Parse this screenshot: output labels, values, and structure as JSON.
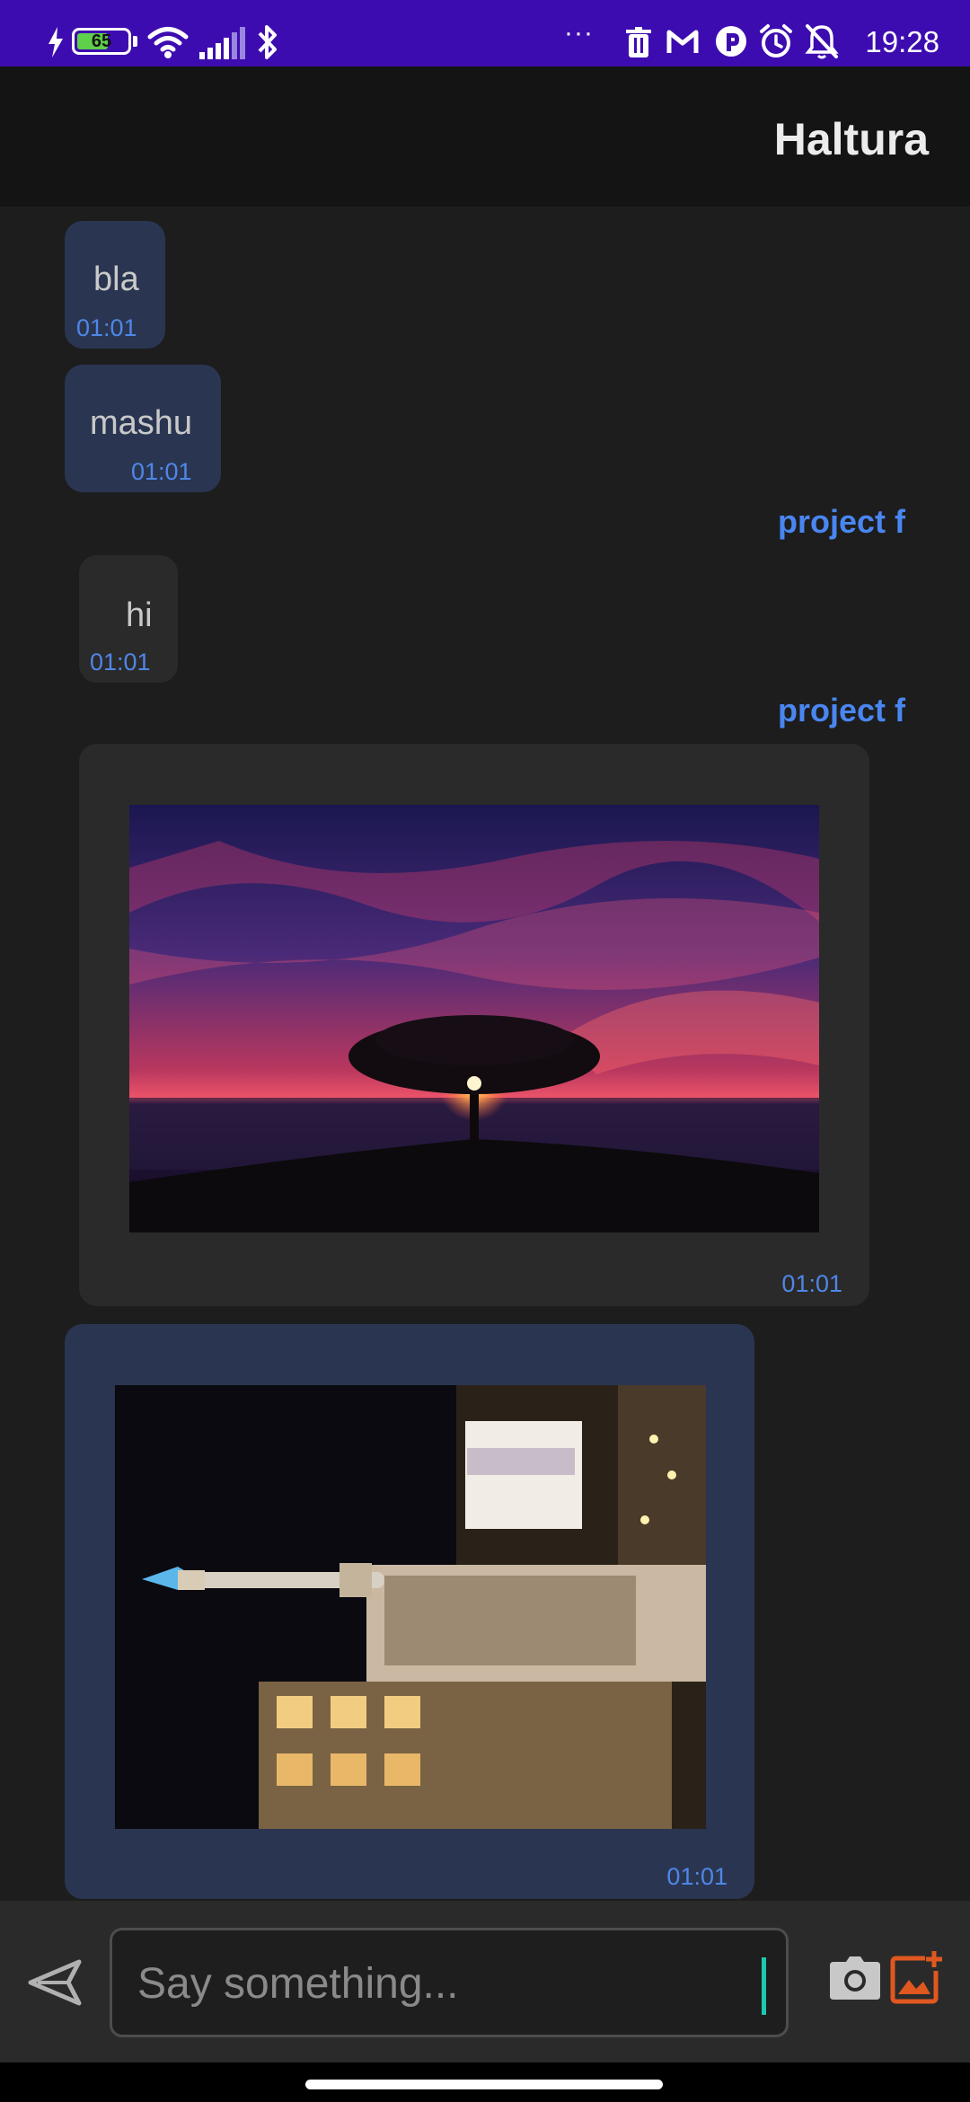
{
  "status_bar": {
    "battery": "65",
    "clock": "19:28",
    "icons": [
      "charging-icon",
      "wifi-icon",
      "signal-icon",
      "bluetooth-icon",
      "more-icon",
      "trash-icon",
      "gmail-icon",
      "app-icon",
      "alarm-icon",
      "bell-off-icon"
    ],
    "more": "···"
  },
  "app_bar": {
    "title": "Haltura"
  },
  "messages": [
    {
      "type": "text",
      "side": "mine",
      "text": "bla",
      "time": "01:01"
    },
    {
      "type": "text",
      "side": "mine",
      "text": "mashu",
      "time": "01:01"
    },
    {
      "type": "sender",
      "name": "project f"
    },
    {
      "type": "text",
      "side": "other",
      "text": "hi",
      "time": "01:01"
    },
    {
      "type": "sender",
      "name": "project f"
    },
    {
      "type": "image",
      "side": "other",
      "image": "sunset-tree-photo",
      "time": "01:01"
    },
    {
      "type": "image",
      "side": "mine",
      "image": "night-column-photo",
      "time": "01:01"
    }
  ],
  "input_bar": {
    "placeholder": "Say something...",
    "send_icon": "send-icon",
    "camera_icon": "camera-icon",
    "gallery_icon": "add-image-icon"
  },
  "colors": {
    "status_bar": "#3d0cb0",
    "app_bar": "#141414",
    "background": "#1d1d1d",
    "mine_bubble": "#2a3651",
    "other_bubble": "#2a2a2a",
    "sender_name": "#4a86f0",
    "time": "#4f86e8",
    "gallery_icon": "#e0581f",
    "caret": "#1ec9b2"
  }
}
